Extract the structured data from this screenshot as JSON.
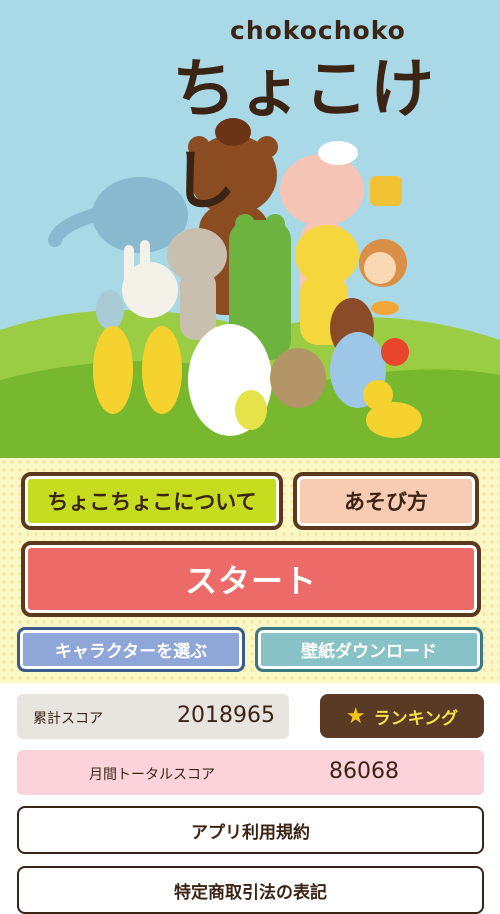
{
  "brand": {
    "latin": "chokochoko",
    "kana": "ちょこけし"
  },
  "menu": {
    "about_label": "ちょこちょこについて",
    "howto_label": "あそび方",
    "start_label": "スタート",
    "choose_character_label": "キャラクターを選ぶ",
    "wallpaper_label": "壁紙ダウンロード"
  },
  "score": {
    "total_label": "累計スコア",
    "total_value": "2018965",
    "ranking_label": "ランキング",
    "monthly_label": "月間トータルスコア",
    "monthly_value": "86068"
  },
  "footer": {
    "terms_label": "アプリ利用規約",
    "law_label": "特定商取引法の表記"
  },
  "colors": {
    "sky": "#a9d9e6",
    "grass": "#8cc63f",
    "about": "#c6dc1e",
    "howto": "#f8cbb3",
    "start": "#ec6a67",
    "chara": "#8ea7d8",
    "wallpaper": "#87c2c7",
    "ranking": "#5a3a24"
  }
}
